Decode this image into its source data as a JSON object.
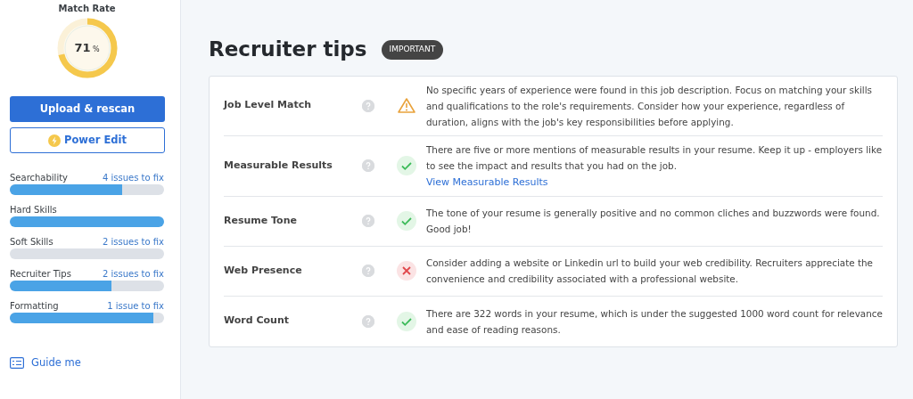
{
  "sidebar": {
    "match_rate": {
      "title": "Match Rate",
      "value": "71",
      "unit": "%",
      "level": 0.71
    },
    "buttons": [
      {
        "label": "Upload & rescan",
        "kind": "primary"
      },
      {
        "label": "Power Edit",
        "kind": "outline"
      }
    ],
    "metrics": [
      {
        "name": "Searchability",
        "issues": "4 issues to fix",
        "level": 0.73
      },
      {
        "name": "Hard Skills",
        "level": 1.0
      },
      {
        "name": "Soft Skills",
        "issues": "2 issues to fix",
        "level": 0
      },
      {
        "name": "Recruiter Tips",
        "issues": "2 issues to fix",
        "level": 0.66
      },
      {
        "name": "Formatting",
        "issues": "1 issue to fix",
        "level": 0.93
      }
    ],
    "guide": "Guide me"
  },
  "main": {
    "title": "Recruiter tips",
    "badge": "IMPORTANT",
    "tips": [
      {
        "name": "Job Level Match",
        "kind": "warning",
        "text": "No specific years of experience were found in this job description. Focus on matching your skills and qualifications to the role's requirements. Consider how your experience, regardless of duration, aligns with the job's key responsibilities before applying."
      },
      {
        "name": "Measurable Results",
        "kind": "pass",
        "text": "There are five or more mentions of measurable results in your resume. Keep it up - employers like to see the impact and results that you had on the job.",
        "link": "View Measurable Results"
      },
      {
        "name": "Resume Tone",
        "kind": "pass",
        "text": "The tone of your resume is generally positive and no common cliches and buzzwords were found. Good job!"
      },
      {
        "name": "Web Presence",
        "kind": "fail",
        "text": "Consider adding a website or Linkedin url to build your web credibility. Recruiters appreciate the convenience and credibility associated with a professional website."
      },
      {
        "name": "Word Count",
        "kind": "pass",
        "text": "There are 322 words in your resume, which is under the suggested 1000 word count for relevance and ease of reading reasons."
      }
    ]
  }
}
